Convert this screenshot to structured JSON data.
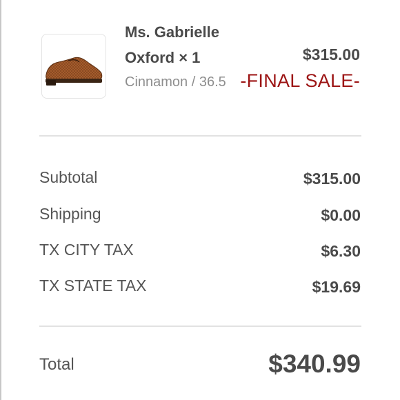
{
  "product": {
    "image_icon": "oxford-shoe-image",
    "name": "Ms. Gabrielle Oxford × 1",
    "variant": "Cinnamon / 36.5",
    "price": "$315.00",
    "final_sale": "-FINAL SALE-"
  },
  "summary": {
    "subtotal_label": "Subtotal",
    "subtotal_value": "$315.00",
    "shipping_label": "Shipping",
    "shipping_value": "$0.00",
    "city_tax_label": "TX CITY TAX",
    "city_tax_value": "$6.30",
    "state_tax_label": "TX STATE TAX",
    "state_tax_value": "$19.69"
  },
  "total": {
    "label": "Total",
    "value": "$340.99"
  },
  "colors": {
    "final_sale": "#9c1414",
    "divider": "#e2e2e2"
  }
}
